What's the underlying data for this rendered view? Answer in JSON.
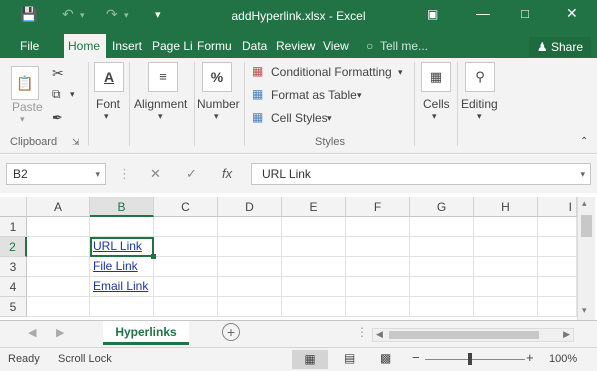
{
  "window": {
    "title": "addHyperlink.xlsx - Excel"
  },
  "tabs": [
    {
      "label": "File"
    },
    {
      "label": "Home"
    },
    {
      "label": "Insert"
    },
    {
      "label": "Page Li"
    },
    {
      "label": "Formu"
    },
    {
      "label": "Data"
    },
    {
      "label": "Review"
    },
    {
      "label": "View"
    },
    {
      "label": "Tell me..."
    }
  ],
  "share_label": "Share",
  "ribbon": {
    "clipboard": {
      "paste": "Paste",
      "group": "Clipboard"
    },
    "font": "Font",
    "alignment": "Alignment",
    "number": "Number",
    "styles": {
      "conditional": "Conditional Formatting",
      "format_table": "Format as Table",
      "cell_styles": "Cell Styles",
      "group": "Styles"
    },
    "cells": "Cells",
    "editing": "Editing"
  },
  "formula_bar": {
    "name_box": "B2",
    "fx": "fx",
    "content": "URL Link"
  },
  "grid": {
    "columns": [
      "A",
      "B",
      "C",
      "D",
      "E",
      "F",
      "G",
      "H",
      "I"
    ],
    "rows": [
      "1",
      "2",
      "3",
      "4",
      "5"
    ],
    "cells": {
      "B2": "URL Link",
      "B3": "File Link",
      "B4": "Email Link"
    }
  },
  "sheets": [
    "Hyperlinks"
  ],
  "status": {
    "mode": "Ready",
    "scroll_lock": "Scroll Lock",
    "zoom": "100%"
  },
  "colors": {
    "accent": "#217346",
    "link": "#1a34a2"
  }
}
